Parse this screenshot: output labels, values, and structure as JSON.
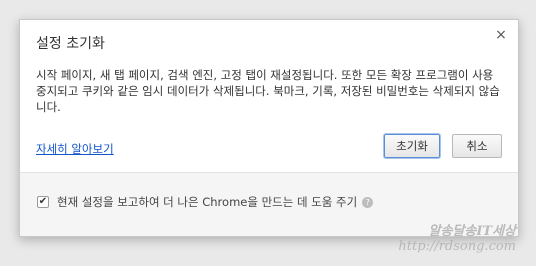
{
  "dialog": {
    "title": "설정 초기화",
    "close_symbol": "×",
    "close_icon": "close-icon",
    "body": "시작 페이지, 새 탭 페이지, 검색 엔진, 고정 탭이 재설정됩니다. 또한 모든 확장 프로그램이 사용 중지되고 쿠키와 같은 임시 데이터가 삭제됩니다. 북마크, 기록, 저장된 비밀번호는 삭제되지 않습니다.",
    "learn_more": "자세히 알아보기",
    "reset_button": "초기화",
    "cancel_button": "취소"
  },
  "footer": {
    "checkbox_checked": true,
    "checkbox_mark": "✔",
    "label": "현재 설정을 보고하여 더 나은 Chrome을 만드는 데 도움 주기",
    "help_symbol": "?",
    "help_icon": "help-icon"
  },
  "watermark": {
    "line1": "알송달송IT세상",
    "line2": "http://rdsong.com"
  },
  "colors": {
    "link": "#1155cc",
    "focus_border": "#5a8fd6",
    "footer_bg": "#f5f5f5"
  }
}
